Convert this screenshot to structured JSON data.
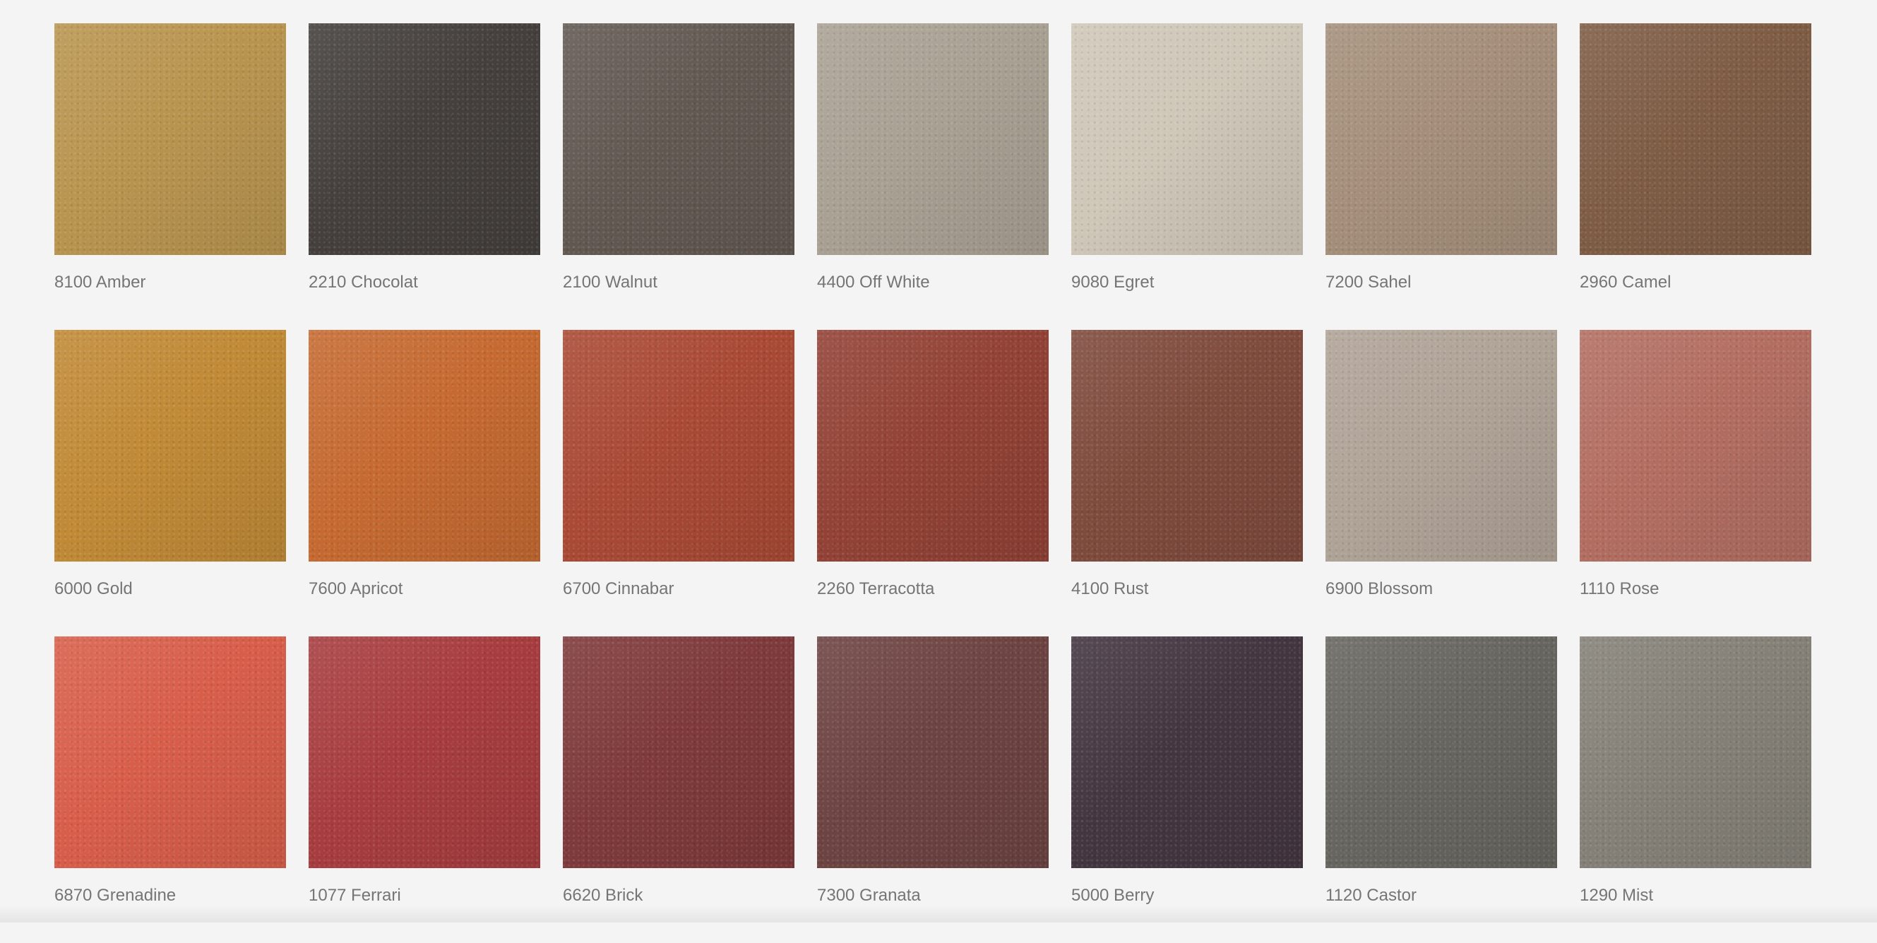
{
  "swatches": [
    {
      "label": "8100 Amber",
      "color": "#b9954f"
    },
    {
      "label": "2210 Chocolat",
      "color": "#45403d"
    },
    {
      "label": "2100 Walnut",
      "color": "#625952"
    },
    {
      "label": "4400 Off White",
      "color": "#a9a193"
    },
    {
      "label": "9080 Egret",
      "color": "#cfc7b8"
    },
    {
      "label": "7200 Sahel",
      "color": "#a58f7b"
    },
    {
      "label": "2960 Camel",
      "color": "#7f5d45"
    },
    {
      "label": "6000 Gold",
      "color": "#c18a36"
    },
    {
      "label": "7600 Apricot",
      "color": "#c66a31"
    },
    {
      "label": "6700 Cinnabar",
      "color": "#aa4a35"
    },
    {
      "label": "2260 Terracotta",
      "color": "#934236"
    },
    {
      "label": "4100 Rust",
      "color": "#7f4b3d"
    },
    {
      "label": "6900 Blossom",
      "color": "#b0a397"
    },
    {
      "label": "1110 Rose",
      "color": "#b36e61"
    },
    {
      "label": "6870 Grenadine",
      "color": "#d85e4a"
    },
    {
      "label": "1077 Ferrari",
      "color": "#a83d40"
    },
    {
      "label": "6620 Brick",
      "color": "#7f3a3c"
    },
    {
      "label": "7300 Granata",
      "color": "#6d4442"
    },
    {
      "label": "5000 Berry",
      "color": "#443641"
    },
    {
      "label": "1120 Castor",
      "color": "#686660"
    },
    {
      "label": "1290 Mist",
      "color": "#858178"
    }
  ]
}
